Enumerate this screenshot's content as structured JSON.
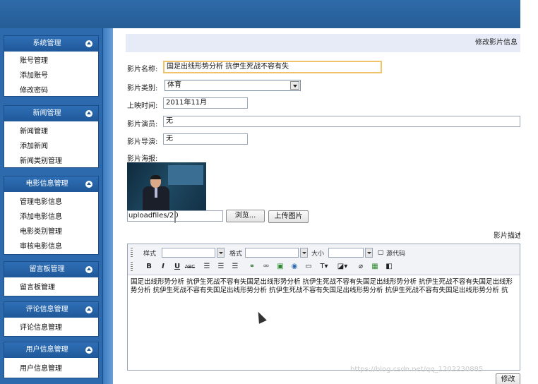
{
  "sidebar": {
    "panels": [
      {
        "title": "系统管理",
        "items": [
          "账号管理",
          "添加账号",
          "修改密码"
        ]
      },
      {
        "title": "新闻管理",
        "items": [
          "新闻管理",
          "添加新闻",
          "新闻类别管理"
        ]
      },
      {
        "title": "电影信息管理",
        "items": [
          "管理电影信息",
          "添加电影信息",
          "电影类别管理",
          "审核电影信息"
        ]
      },
      {
        "title": "留言板管理",
        "items": [
          "留言板管理"
        ]
      },
      {
        "title": "评论信息管理",
        "items": [
          "评论信息管理"
        ]
      },
      {
        "title": "用户信息管理",
        "items": [
          "用户信息管理"
        ]
      }
    ]
  },
  "main": {
    "header_title": "修改影片信息",
    "fields": {
      "name_label": "影片名称:",
      "name_value": "国足出线形势分析 抗伊生死战不容有失",
      "type_label": "影片类别:",
      "type_value": "体育",
      "date_label": "上映时间:",
      "date_value": "2011年11月",
      "actor_label": "影片演员:",
      "actor_value": "无",
      "director_label": "影片导演:",
      "director_value": "无",
      "poster_label": "影片海报:",
      "upload_path": "uploadfiles/20",
      "browse_label": "浏览...",
      "upload_label": "上传图片",
      "desc_label": "影片描述"
    },
    "editor": {
      "style_label": "样式",
      "format_label": "格式",
      "size_label": "大小",
      "source_label": "源代码",
      "content": "国足出线形势分析 抗伊生死战不容有失国足出线形势分析 抗伊生死战不容有失国足出线形势分析 抗伊生死战不容有失国足出线形势分析 抗伊生死战不容有失国足出线形势分析 抗伊生死战不容有失国足出线形势分析 抗伊生死战不容有失国足出线形势分析 抗"
    },
    "submit_label": "修改"
  },
  "watermark": "https://blog.csdn.net/qq_1202230885"
}
